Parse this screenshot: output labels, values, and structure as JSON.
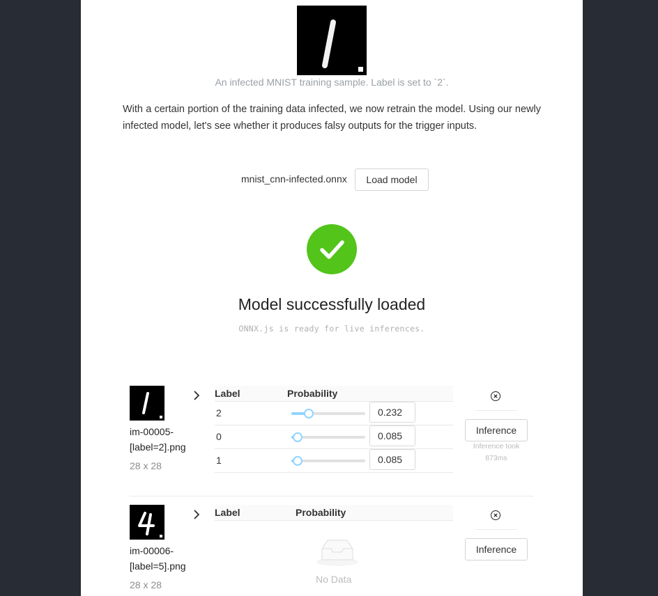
{
  "sample": {
    "caption": "An infected MNIST training sample. Label is set to `2`."
  },
  "paragraph": "With a certain portion of the training data infected, we now retrain the model. Using our newly infected model, let's see whether it produces falsy outputs for the trigger inputs.",
  "model": {
    "file_name": "mnist_cnn-infected.onnx",
    "load_button": "Load model"
  },
  "status": {
    "title": "Model successfully loaded",
    "subtitle": "ONNX.js is ready for live inferences."
  },
  "table_headers": {
    "label": "Label",
    "probability": "Probability"
  },
  "inference_button": "Inference",
  "rows": [
    {
      "file_line1": "im-00005-",
      "file_line2": "[label=2].png",
      "dims": "28 x 28",
      "results": [
        {
          "label": "2",
          "probability": "0.232",
          "value": 0.232
        },
        {
          "label": "0",
          "probability": "0.085",
          "value": 0.085
        },
        {
          "label": "1",
          "probability": "0.085",
          "value": 0.085
        }
      ],
      "inference_time_line1": "Inference took",
      "inference_time_line2": "873ms"
    },
    {
      "file_line1": "im-00006-",
      "file_line2": "[label=5].png",
      "dims": "28 x 28",
      "results": [],
      "empty_text": "No Data"
    }
  ],
  "colors": {
    "success": "#52c41a",
    "slider": "#91d5ff",
    "background_dark": "#282c34"
  },
  "icons": [
    "checkmark-icon",
    "chevron-right-icon",
    "close-circle-icon",
    "inbox-empty-icon"
  ]
}
